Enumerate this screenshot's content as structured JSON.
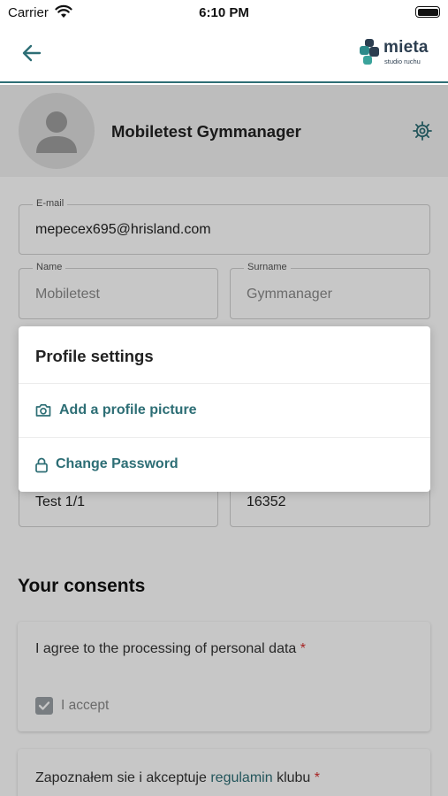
{
  "status_bar": {
    "carrier": "Carrier",
    "time": "6:10 PM"
  },
  "app_bar": {
    "logo_text": "mieta",
    "logo_subtext": "studio ruchu"
  },
  "profile": {
    "name": "Mobiletest Gymmanager"
  },
  "form": {
    "email": {
      "label": "E-mail",
      "value": "mepecex695@hrisland.com"
    },
    "name": {
      "label": "Name",
      "value": "Mobiletest"
    },
    "surname": {
      "label": "Surname",
      "value": "Gymmanager"
    },
    "address_line": {
      "value": "Test 1/1"
    },
    "postal_code": {
      "value": "16352"
    }
  },
  "consents": {
    "title": "Your consents",
    "items": [
      {
        "text": "I agree to the processing of personal data",
        "required_mark": "*",
        "checkbox_label": "I accept",
        "checked": true
      },
      {
        "text_before": "Zapoznałem sie i akceptuje",
        "link_text": "regulamin",
        "text_after": "klubu",
        "required_mark": "*"
      }
    ]
  },
  "menu": {
    "title": "Profile settings",
    "items": [
      {
        "label": "Add a profile picture",
        "icon": "camera-icon"
      },
      {
        "label": "Change Password",
        "icon": "lock-icon"
      }
    ]
  },
  "colors": {
    "accent": "#2d6e75",
    "required": "#d62f2f",
    "overlay": "rgba(0,0,0,0.22)"
  }
}
